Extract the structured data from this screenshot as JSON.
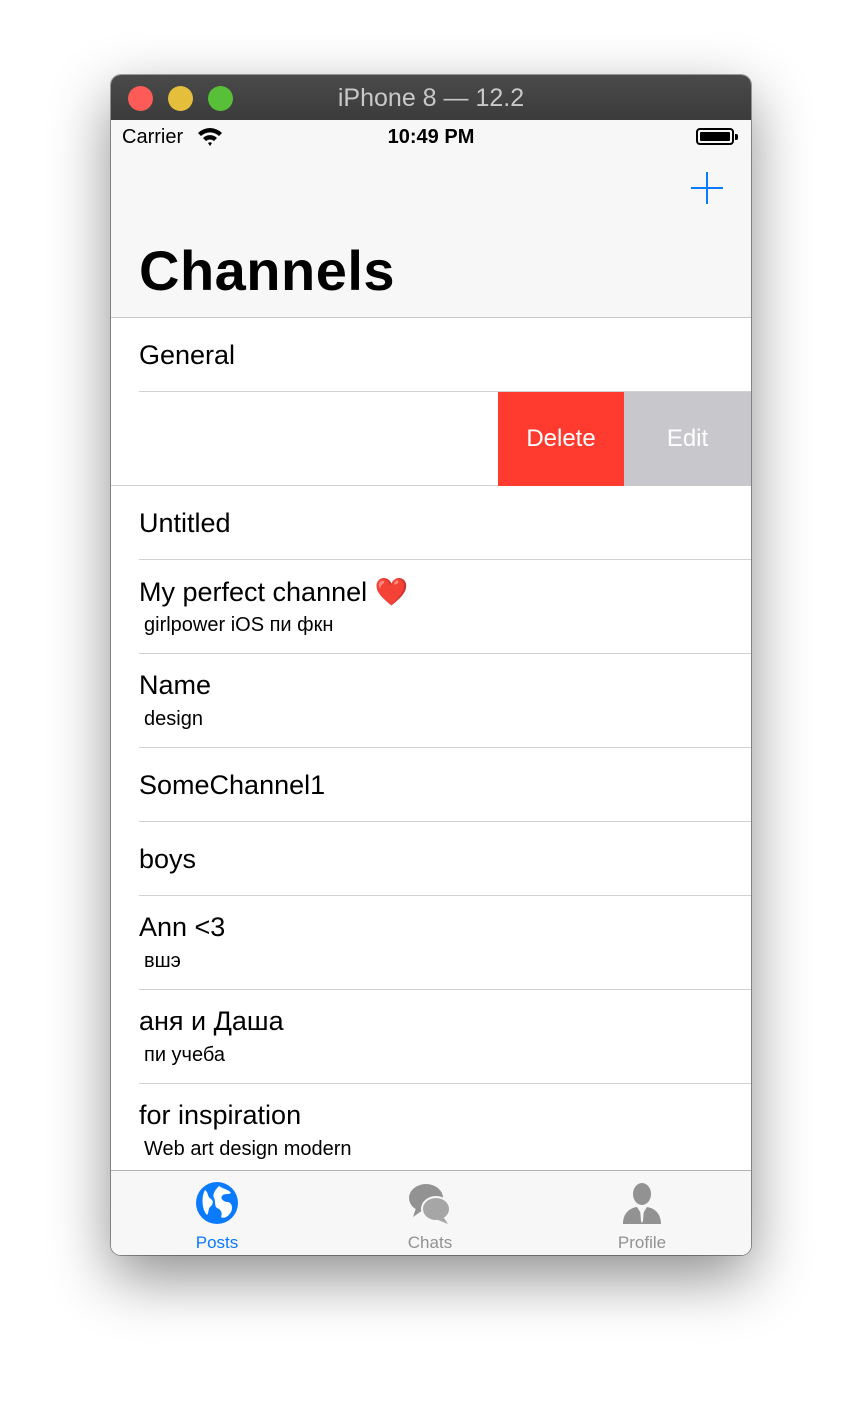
{
  "window": {
    "title": "iPhone 8 — 12.2"
  },
  "status_bar": {
    "carrier": "Carrier",
    "time": "10:49 PM"
  },
  "nav": {
    "title": "Channels",
    "add_icon": "plus-icon"
  },
  "channels": [
    {
      "title": "General",
      "subtitle": ""
    },
    {
      "title": "",
      "subtitle": "",
      "swiped": true
    },
    {
      "title": "Untitled",
      "subtitle": ""
    },
    {
      "title": "My perfect channel",
      "emoji": "❤️",
      "subtitle": "girlpower iOS пи фкн"
    },
    {
      "title": "Name",
      "subtitle": "design"
    },
    {
      "title": "SomeChannel1",
      "subtitle": ""
    },
    {
      "title": "boys",
      "subtitle": ""
    },
    {
      "title": "Ann <3",
      "subtitle": "вшэ"
    },
    {
      "title": "аня и Даша",
      "subtitle": "пи учеба"
    },
    {
      "title": "for inspiration",
      "subtitle": "Web art design modern"
    }
  ],
  "swipe_actions": {
    "delete_label": "Delete",
    "edit_label": "Edit"
  },
  "tabs": [
    {
      "label": "Posts",
      "icon": "globe-icon",
      "active": true
    },
    {
      "label": "Chats",
      "icon": "chat-bubbles-icon",
      "active": false
    },
    {
      "label": "Profile",
      "icon": "person-icon",
      "active": false
    }
  ],
  "colors": {
    "accent": "#0a7aff",
    "delete": "#ff3b30",
    "edit": "#c7c7cc",
    "inactive_tab": "#929292"
  }
}
